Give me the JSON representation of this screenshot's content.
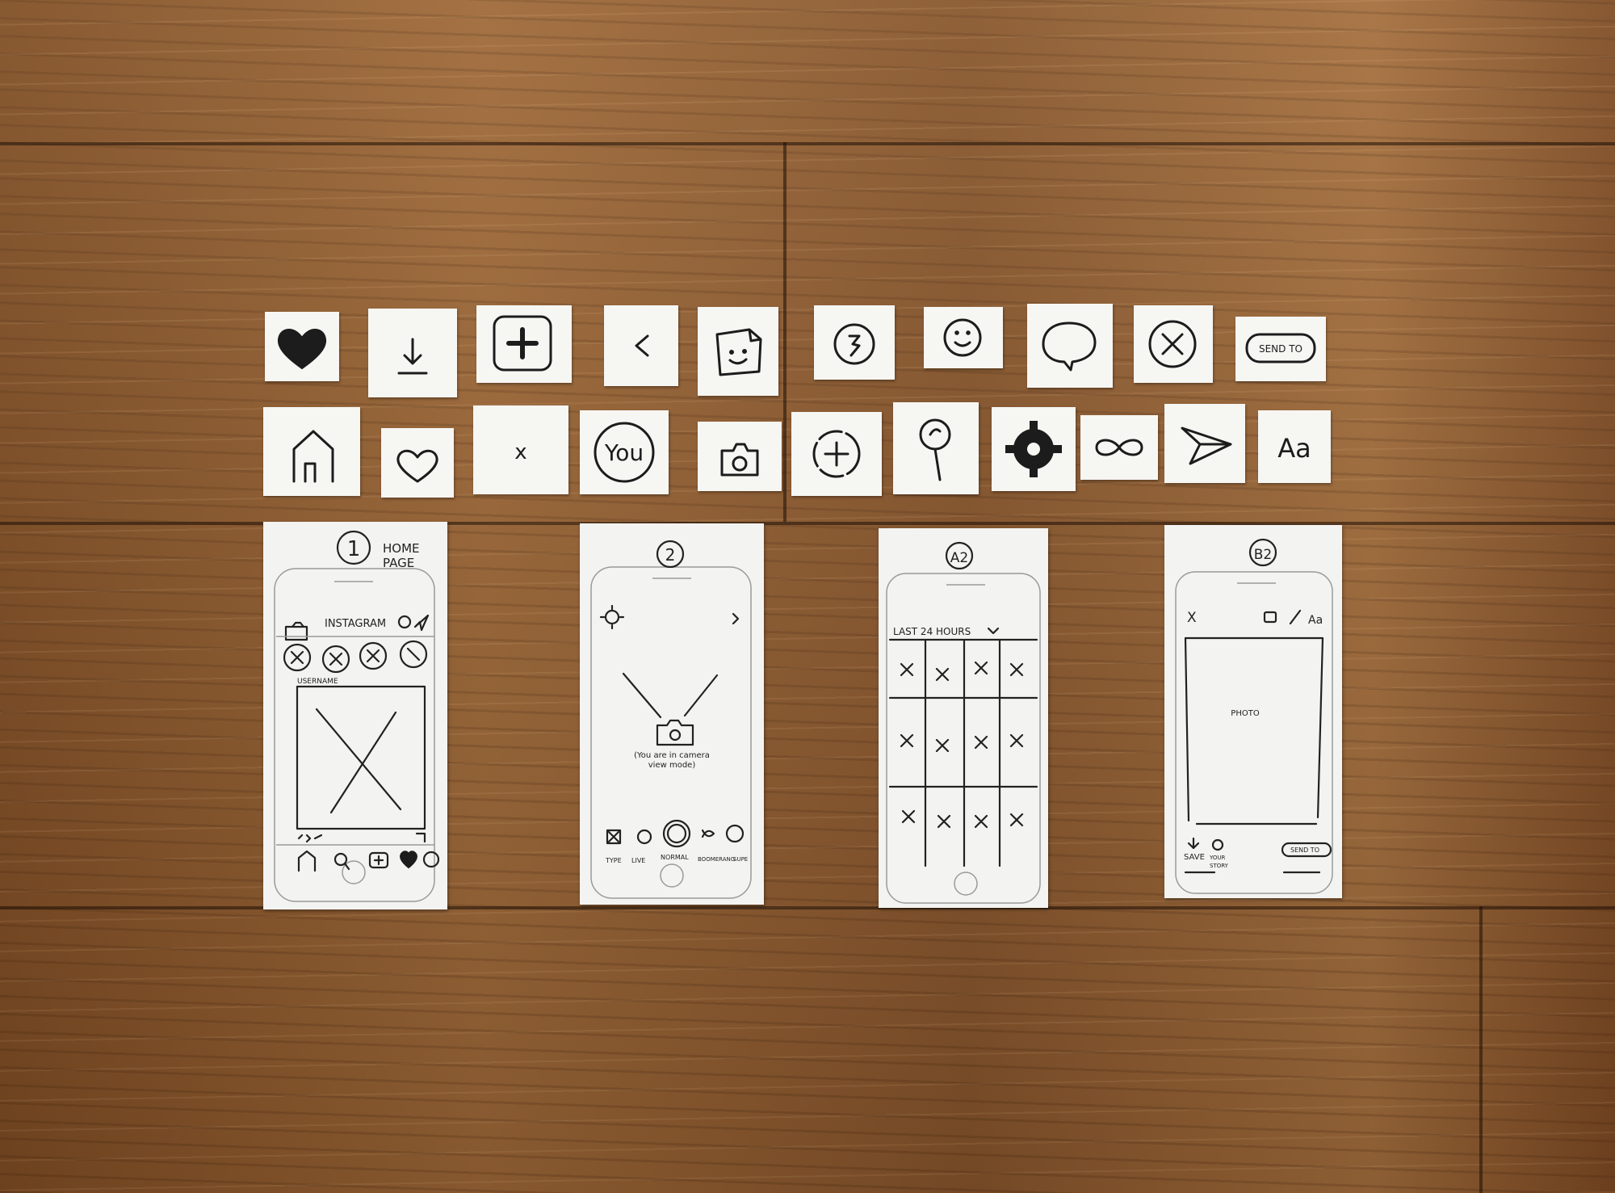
{
  "icons_row1": [
    "filled-heart-icon",
    "download-arrow-icon",
    "plus-square-icon",
    "back-chevron-icon",
    "sticker-face-icon",
    "timer-icon",
    "smiley-face-icon",
    "chat-bubble-icon",
    "circle-x-icon",
    "send-to-button"
  ],
  "icons_row2": [
    "home-icon",
    "heart-outline-icon",
    "x-icon",
    "you-profile-icon",
    "camera-icon",
    "plus-circle-icon",
    "search-icon",
    "settings-gear-icon",
    "infinity-icon",
    "paper-plane-icon",
    "text-tool-icon"
  ],
  "cards": {
    "send_to": "SEND TO",
    "x_mark": "x",
    "you": "You",
    "aa": "Aa"
  },
  "screen1": {
    "number": "1",
    "title_line1": "HOME",
    "title_line2": "PAGE",
    "app_title": "INSTAGRAM",
    "username": "USERNAME"
  },
  "screen2": {
    "number": "2",
    "camera_note_line1": "(You are in camera",
    "camera_note_line2": "view mode)",
    "bottom_labels": [
      "TYPE",
      "LIVE",
      "NORMAL",
      "BOOMERANG",
      "SUPE"
    ]
  },
  "screenA2": {
    "number": "A2",
    "header": "LAST 24 HOURS"
  },
  "screenB2": {
    "number": "B2",
    "x_close": "X",
    "aa": "Aa",
    "photo": "PHOTO",
    "save": "SAVE",
    "your_story_line1": "YOUR",
    "your_story_line2": "STORY",
    "send_to": "SEND TO"
  }
}
